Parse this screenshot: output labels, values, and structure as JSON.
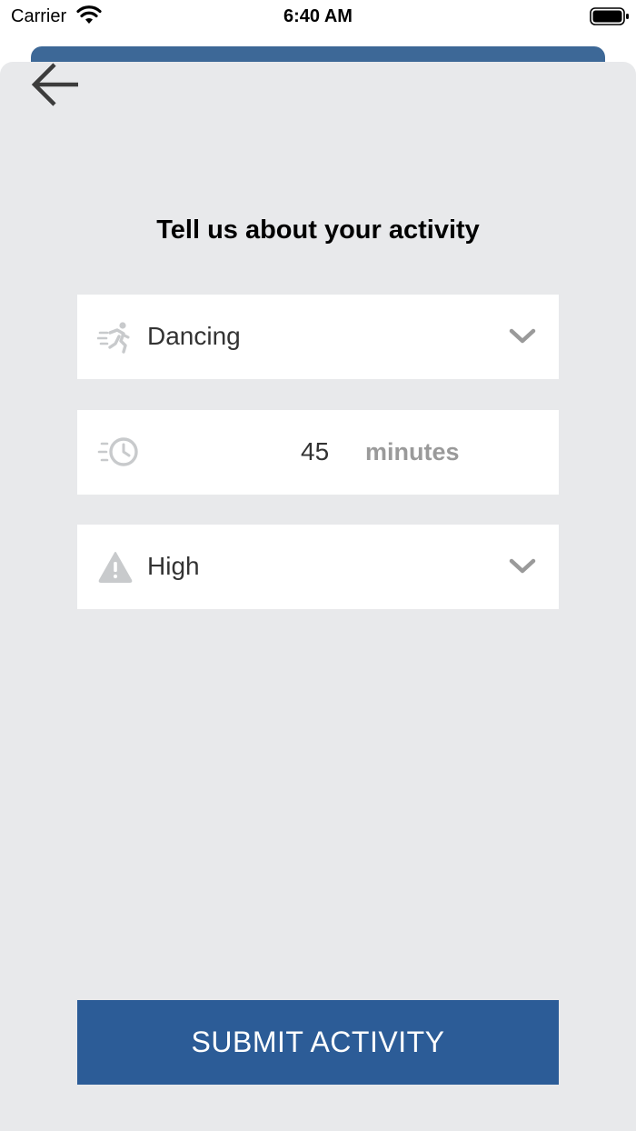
{
  "status_bar": {
    "carrier": "Carrier",
    "time": "6:40 AM"
  },
  "colors": {
    "sheet_background": "#e8e9eb",
    "behind_header": "#3d6897",
    "submit_background": "#2c5c97",
    "icon_gray": "#c8cacc"
  },
  "screen": {
    "heading": "Tell us about your activity"
  },
  "activity_field": {
    "icon": "running-icon",
    "value": "Dancing"
  },
  "duration_field": {
    "icon": "timer-icon",
    "value": "45",
    "unit": "minutes"
  },
  "intensity_field": {
    "icon": "warning-icon",
    "value": "High"
  },
  "submit": {
    "label": "SUBMIT ACTIVITY"
  }
}
